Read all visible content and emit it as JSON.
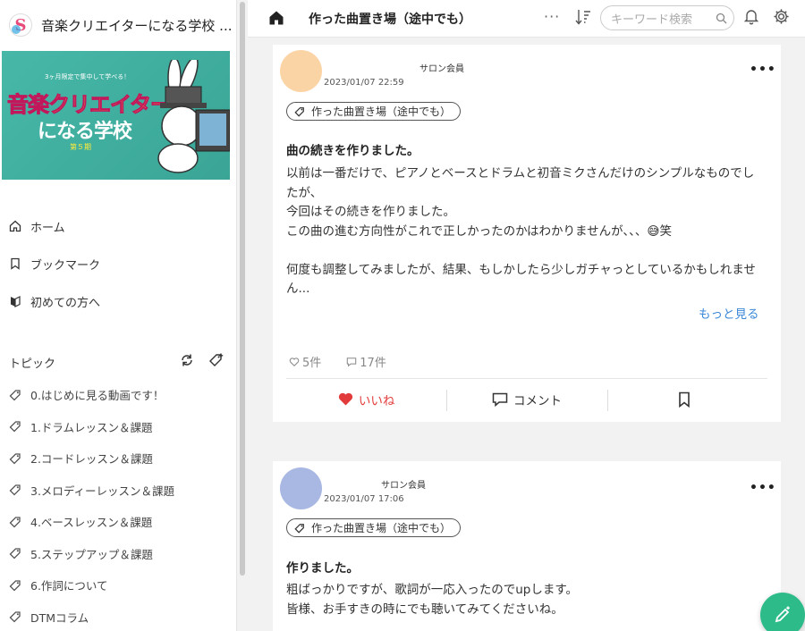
{
  "sidebar": {
    "title": "音楽クリエイターになる学校 ...",
    "banner": {
      "small_text": "3ヶ月限定で集中して学べる！",
      "line1": "音楽クリエイター",
      "line2": "になる学校",
      "badge": "第５期"
    },
    "nav": [
      {
        "label": "ホーム",
        "icon": "home-outline-icon"
      },
      {
        "label": "ブックマーク",
        "icon": "bookmark-icon"
      },
      {
        "label": "初めての方へ",
        "icon": "beginner-mark-icon"
      }
    ],
    "topics_heading": "トピック",
    "topics": [
      "0.はじめに見る動画です！",
      "1.ドラムレッスン＆課題",
      "2.コードレッスン＆課題",
      "3.メロディーレッスン＆課題",
      "4.ベースレッスン＆課題",
      "5.ステップアップ＆課題",
      "6.作詞について",
      "DTMコラム"
    ]
  },
  "topbar": {
    "title": "作った曲置き場（途中でも）",
    "more": "···",
    "search_placeholder": "キーワード検索"
  },
  "posts": [
    {
      "role": "サロン会員",
      "date": "2023/01/07 22:59",
      "tag": "作った曲置き場（途中でも）",
      "title": "曲の続きを作りました。",
      "body": [
        "以前は一番だけで、ピアノとベースとドラムと初音ミクさんだけのシンプルなものでし",
        "たが、",
        "今回はその続きを作りました。",
        "この曲の進む方向性がこれで正しかったのかはわかりませんが、、、😅笑",
        "",
        "何度も調整してみましたが、結果、もしかしたら少しガチャっとしているかもしれませ",
        "ん..."
      ],
      "read_more": "もっと見る",
      "likes": "5件",
      "comments": "17件",
      "like_label": "いいね",
      "comment_label": "コメント",
      "avatar_color": "#fbd4a6"
    },
    {
      "role": "サロン会員",
      "date": "2023/01/07 17:06",
      "tag": "作った曲置き場（途中でも）",
      "title": "作りました。",
      "body": [
        "粗ばっかりですが、歌詞が一応入ったのでupします。",
        "皆様、お手すきの時にでも聴いてみてくださいね。"
      ],
      "avatar_color": "#a8b8e3"
    }
  ],
  "colors": {
    "accent_link": "#3b88d8",
    "like": "#e23b3b",
    "fab": "#2dbb8a"
  }
}
